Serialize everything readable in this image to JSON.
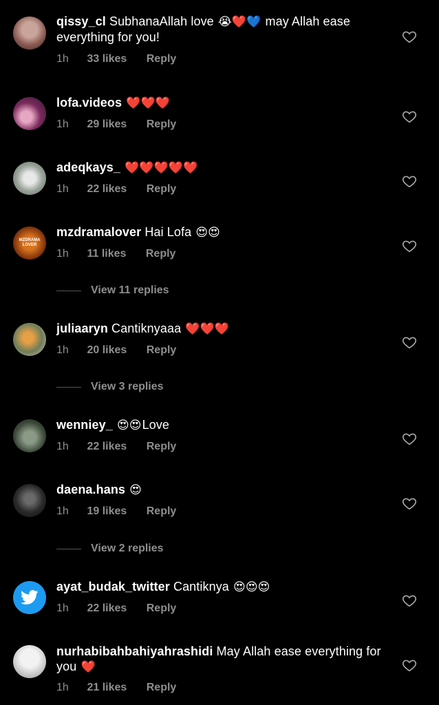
{
  "comments": [
    {
      "username": "qissy_cl",
      "text": "SubhanaAllah love",
      "emojis_after": "😭❤️💙",
      "text2": " may Allah ease everything for you!",
      "time": "1h",
      "likes": "33 likes",
      "reply": "Reply"
    },
    {
      "username": "lofa.videos",
      "text": "",
      "emojis_after": "❤️❤️❤️",
      "text2": "",
      "time": "1h",
      "likes": "29 likes",
      "reply": "Reply"
    },
    {
      "username": "adeqkays_",
      "text": "",
      "emojis_after": "❤️❤️❤️❤️❤️",
      "text2": "",
      "time": "1h",
      "likes": "22 likes",
      "reply": "Reply"
    },
    {
      "username": "mzdramalover",
      "text": "Hai Lofa",
      "emojis_after": "😍😍",
      "text2": "",
      "time": "1h",
      "likes": "11 likes",
      "reply": "Reply",
      "view_replies": "View 11 replies",
      "avatar_text": "MZDRAMA LOVER"
    },
    {
      "username": "juliaaryn",
      "text": "Cantiknyaaa",
      "emojis_after": "❤️❤️❤️",
      "text2": "",
      "time": "1h",
      "likes": "20 likes",
      "reply": "Reply",
      "view_replies": "View 3 replies"
    },
    {
      "username": "wenniey_",
      "text": "",
      "emojis_after": "😍😍",
      "text2": "Love",
      "time": "1h",
      "likes": "22 likes",
      "reply": "Reply"
    },
    {
      "username": "daena.hans",
      "text": "",
      "emojis_after": "😍",
      "text2": "",
      "time": "1h",
      "likes": "19 likes",
      "reply": "Reply",
      "view_replies": "View 2 replies"
    },
    {
      "username": "ayat_budak_twitter",
      "text": "Cantiknya",
      "emojis_after": "😍😍😍",
      "text2": "",
      "time": "1h",
      "likes": "22 likes",
      "reply": "Reply"
    },
    {
      "username": "nurhabibahbahiyahrashidi",
      "text": "May Allah ease everything for you",
      "emojis_after": "❤️",
      "text2": "",
      "time": "1h",
      "likes": "21 likes",
      "reply": "Reply"
    }
  ],
  "colors": {
    "background": "#000000",
    "muted": "#8e8e8e",
    "twitter_blue": "#1d9bf0"
  },
  "icons": {
    "heart": "heart-outline-icon",
    "twitter": "twitter-bird-icon"
  }
}
